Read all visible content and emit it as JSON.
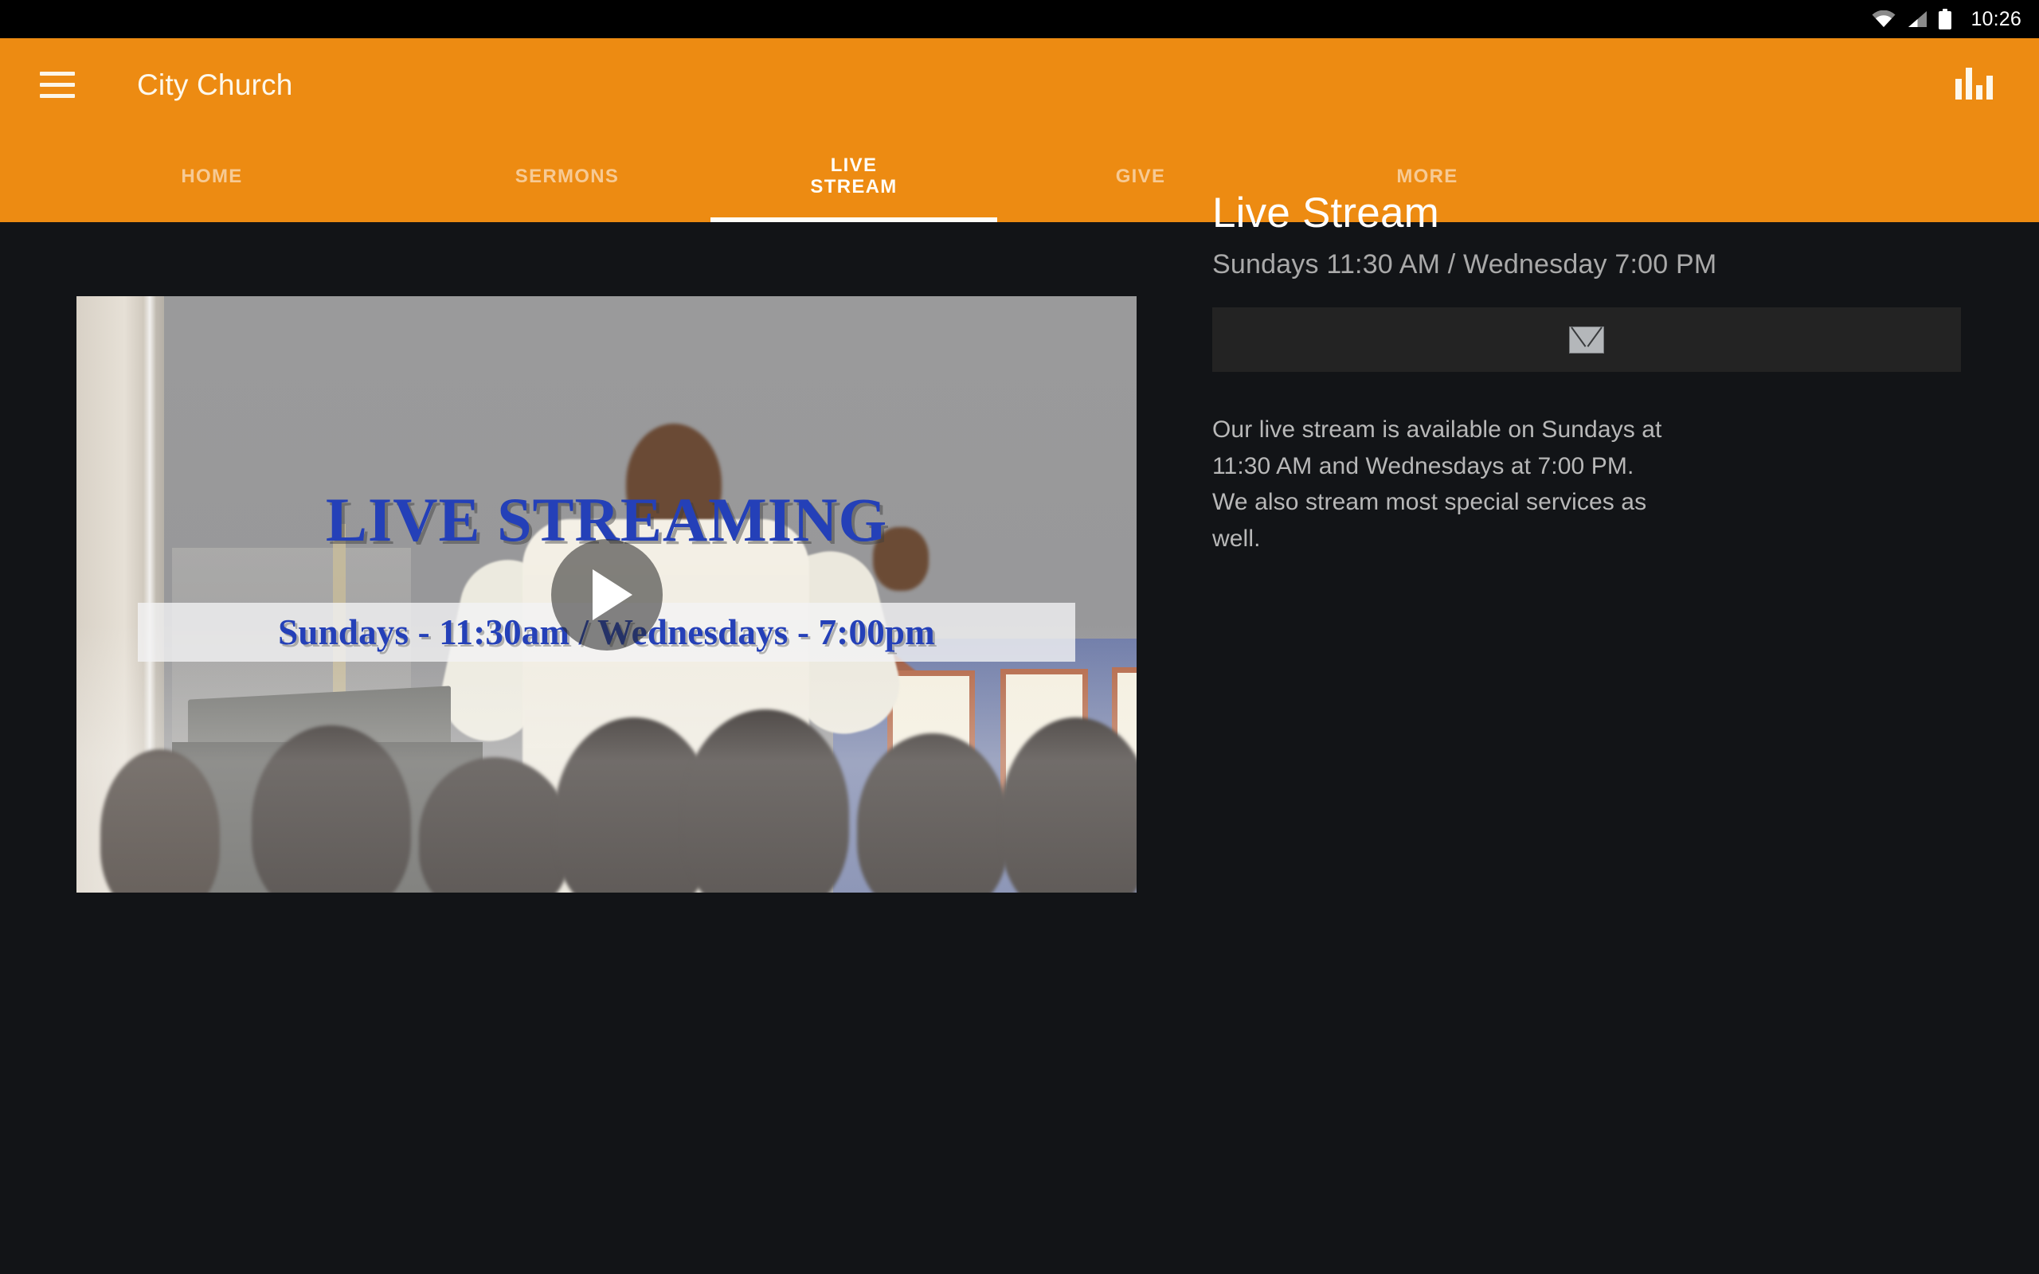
{
  "status_bar": {
    "time": "10:26",
    "icons": [
      "wifi-icon",
      "cellular-signal-icon",
      "battery-icon"
    ]
  },
  "app_bar": {
    "title": "City Church",
    "menu_icon": "hamburger-menu-icon",
    "action_icon": "bar-chart-icon",
    "background_color": "#ED8B12",
    "text_color": "#FDF8EC"
  },
  "tabs": {
    "active_index": 2,
    "items": [
      {
        "label": "HOME"
      },
      {
        "label": "SERMONS"
      },
      {
        "label": "LIVE\nSTREAM"
      },
      {
        "label": "GIVE"
      },
      {
        "label": "MORE"
      }
    ]
  },
  "video": {
    "overlay_title": "LIVE STREAMING",
    "overlay_caption": "Sundays - 11:30am / Wednesdays - 7:00pm",
    "overlay_text_color": "#2440B8",
    "play_icon": "play-button-icon"
  },
  "panel": {
    "title": "Live Stream",
    "subtitle": "Sundays 11:30 AM / Wednesday 7:00 PM",
    "email_icon": "envelope-icon",
    "description": "Our live stream is available on Sundays at 11:30 AM and Wednesdays at 7:00 PM.  We also stream most special services as well.",
    "background_color": "#121417"
  }
}
